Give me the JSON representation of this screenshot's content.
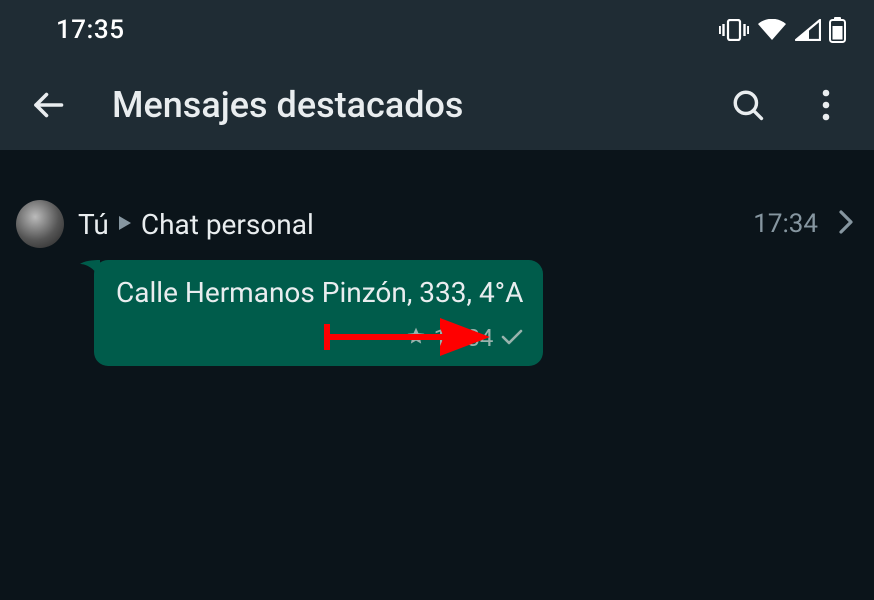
{
  "status": {
    "time": "17:35"
  },
  "appbar": {
    "title": "Mensajes destacados"
  },
  "item": {
    "sender": "Tú",
    "chat_name": "Chat personal",
    "time": "17:34"
  },
  "message": {
    "text": "Calle Hermanos Pinzón, 333, 4°A",
    "time": "17:34"
  }
}
